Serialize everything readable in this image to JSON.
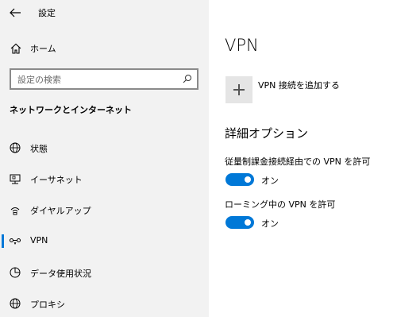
{
  "app": {
    "title": "設定"
  },
  "nav": {
    "home": "ホーム",
    "search_placeholder": "設定の検索",
    "section": "ネットワークとインターネット",
    "items": [
      {
        "label": "状態",
        "icon": "globe-icon"
      },
      {
        "label": "イーサネット",
        "icon": "monitor-icon"
      },
      {
        "label": "ダイヤルアップ",
        "icon": "dialup-icon"
      },
      {
        "label": "VPN",
        "icon": "vpn-icon",
        "active": true
      },
      {
        "label": "データ使用状況",
        "icon": "pie-chart-icon"
      },
      {
        "label": "プロキシ",
        "icon": "globe-icon"
      }
    ]
  },
  "main": {
    "title": "VPN",
    "add_vpn": "VPN 接続を追加する",
    "advanced_title": "詳細オプション",
    "options": [
      {
        "label": "従量制課金接続経由での VPN を許可",
        "state": "オン",
        "on": true
      },
      {
        "label": "ローミング中の VPN を許可",
        "state": "オン",
        "on": true
      }
    ]
  },
  "colors": {
    "accent": "#0078d7",
    "left_bg": "#f2f2f2"
  }
}
